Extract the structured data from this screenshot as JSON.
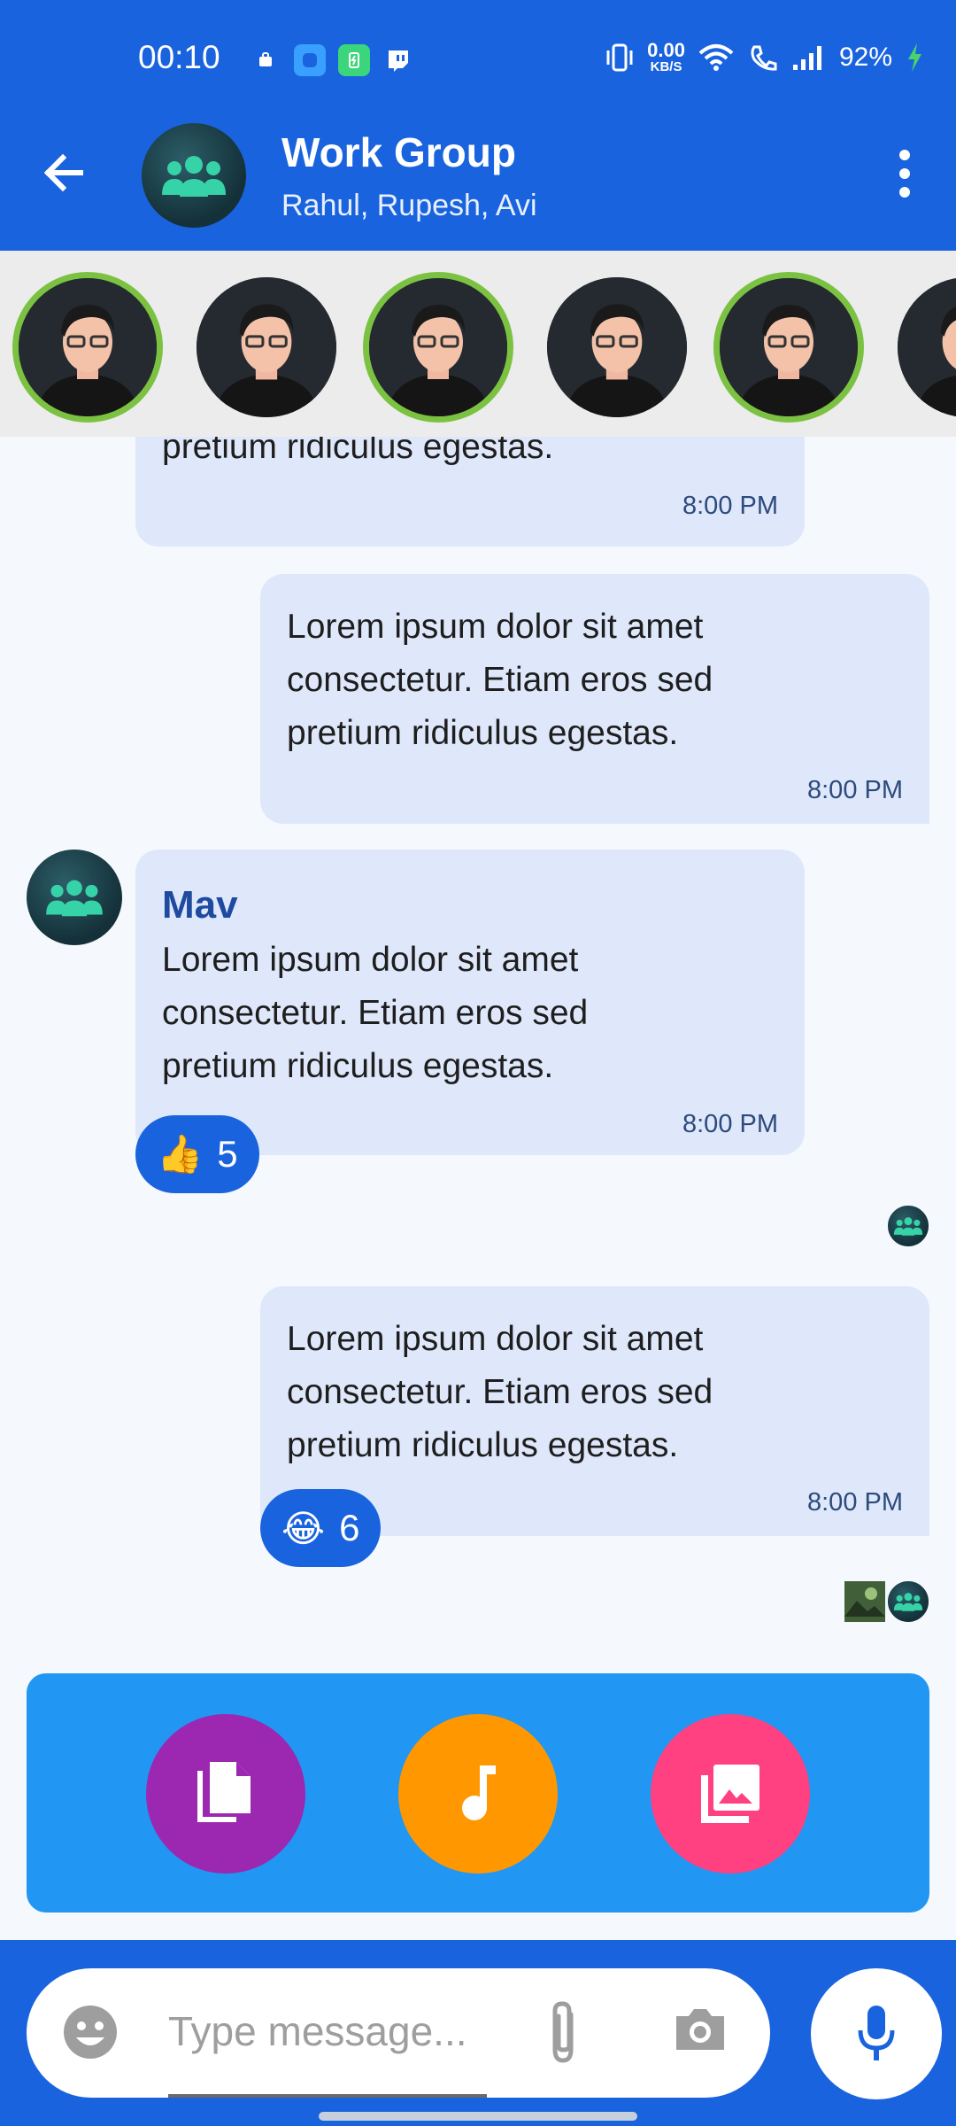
{
  "status_bar": {
    "time": "00:10",
    "net_speed_value": "0.00",
    "net_speed_unit": "KB/S",
    "battery": "92%"
  },
  "header": {
    "title": "Work Group",
    "subtitle": "Rahul, Rupesh, Avi"
  },
  "colors": {
    "primary": "#1a63de",
    "ring": "#7cc242",
    "bubble": "#dfe8fb",
    "attach_panel": "#2196f3",
    "docs": "#9c27b0",
    "audio": "#ff9800",
    "gallery": "#ff4081"
  },
  "messages": [
    {
      "text_line3": "pretium ridiculus egestas.",
      "time": "8:00 PM"
    },
    {
      "text": "Lorem ipsum dolor sit amet consectetur. Etiam eros sed pretium ridiculus egestas.",
      "time": "8:00 PM"
    },
    {
      "sender": "Mav",
      "text": "Lorem ipsum dolor sit amet consectetur. Etiam eros sed pretium ridiculus egestas.",
      "time": "8:00 PM",
      "reaction_emoji": "👍",
      "reaction_count": "5"
    },
    {
      "text": "Lorem ipsum dolor sit amet consectetur. Etiam eros sed pretium ridiculus egestas.",
      "time": "8:00 PM",
      "reaction_emoji": "😂",
      "reaction_count": "6"
    }
  ],
  "composer": {
    "placeholder": "Type message..."
  }
}
